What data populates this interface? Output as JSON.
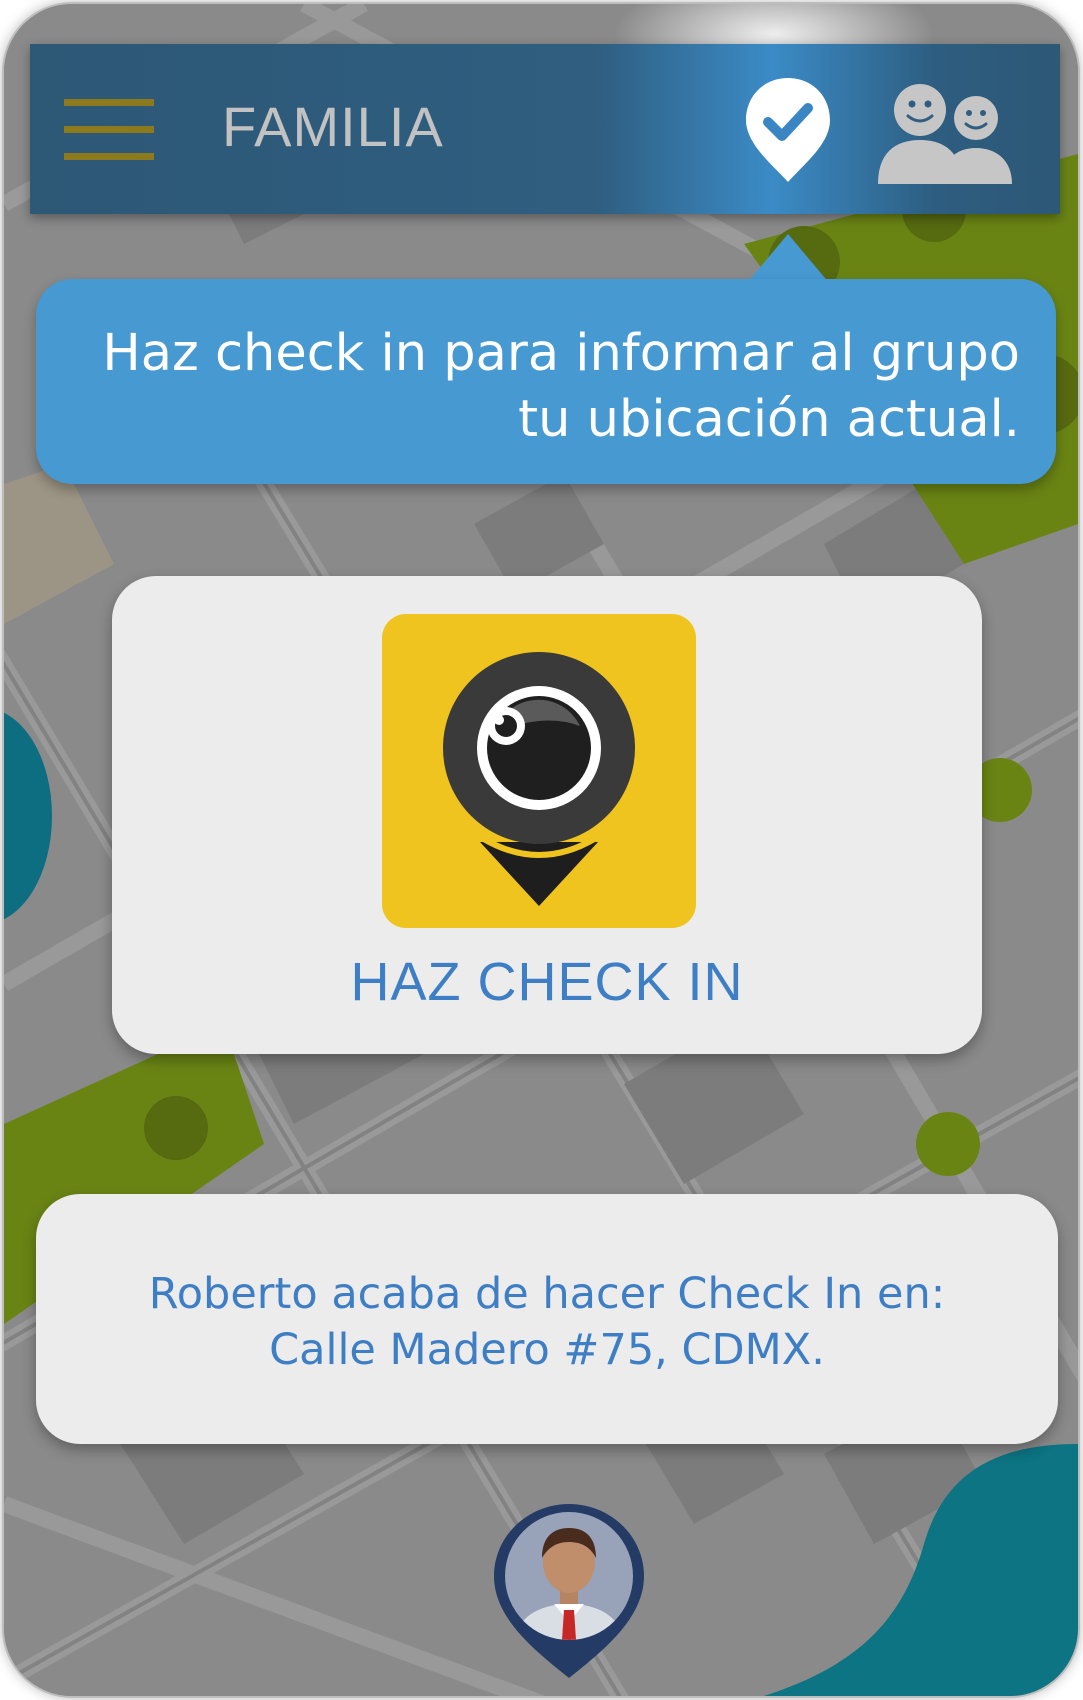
{
  "header": {
    "title": "FAMILIA",
    "menu_icon": "hamburger-menu-icon",
    "checkin_icon": "location-check-icon",
    "group_icon": "group-people-icon"
  },
  "tooltip": {
    "line1": "Haz check in para informar al grupo",
    "line2": "tu ubicación actual."
  },
  "checkin_card": {
    "label": "HAZ CHECK IN",
    "logo_icon": "map-pin-eye-logo",
    "logo_color": "#efc41e"
  },
  "notification": {
    "line1": "Roberto acaba de hacer Check In en:",
    "line2": "Calle Madero #75, CDMX."
  },
  "map": {
    "avatar_icon": "user-avatar-pin-icon"
  },
  "colors": {
    "header_bg": "#2d5876",
    "accent_blue": "#4799d2",
    "text_blue": "#3d7ec4",
    "map_green": "#6a8414",
    "map_teal": "#0c7482"
  }
}
